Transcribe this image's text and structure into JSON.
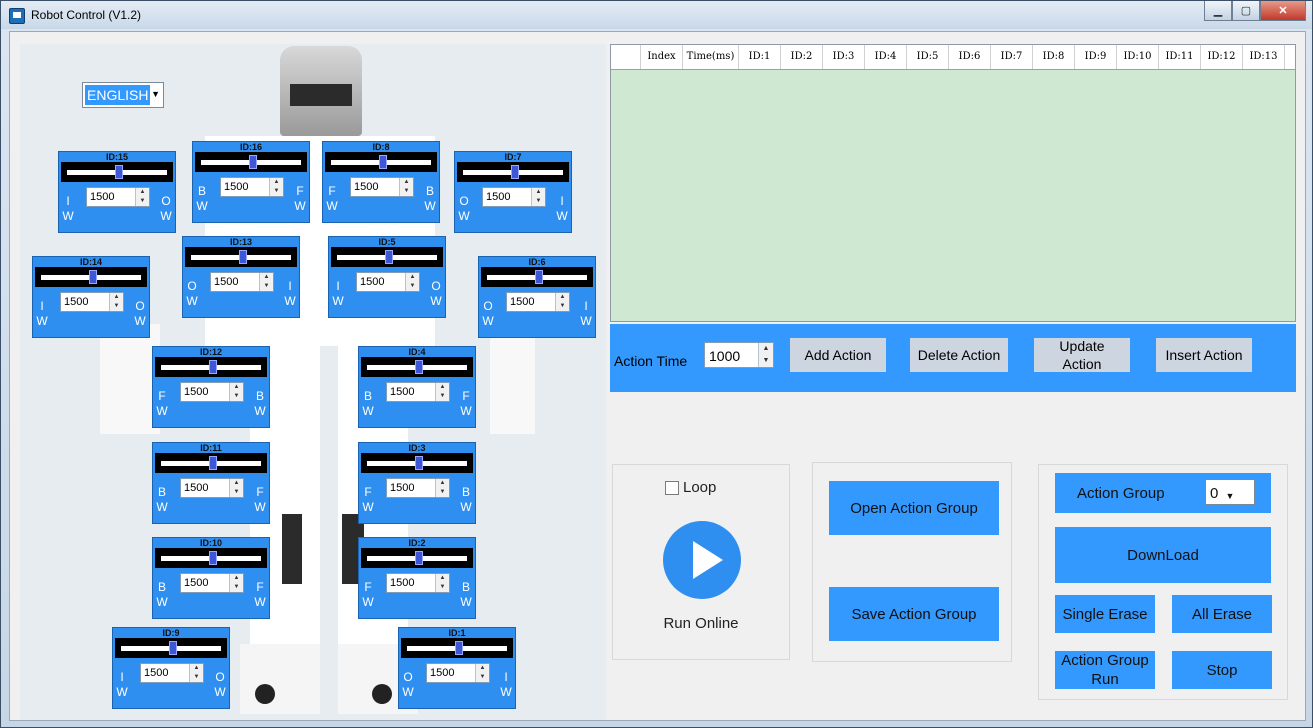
{
  "window": {
    "title": "Robot Control (V1.2)",
    "min": "▁",
    "max": "▢",
    "close": "✕"
  },
  "language": {
    "selected": "ENGLISH"
  },
  "servos": [
    {
      "id": "ID:15",
      "value": "1500",
      "left": "I\nW",
      "right": "O\nW"
    },
    {
      "id": "ID:16",
      "value": "1500",
      "left": "B\nW",
      "right": "F\nW"
    },
    {
      "id": "ID:8",
      "value": "1500",
      "left": "F\nW",
      "right": "B\nW"
    },
    {
      "id": "ID:7",
      "value": "1500",
      "left": "O\nW",
      "right": "I\nW"
    },
    {
      "id": "ID:14",
      "value": "1500",
      "left": "I\nW",
      "right": "O\nW"
    },
    {
      "id": "ID:13",
      "value": "1500",
      "left": "O\nW",
      "right": "I\nW"
    },
    {
      "id": "ID:5",
      "value": "1500",
      "left": "I\nW",
      "right": "O\nW"
    },
    {
      "id": "ID:6",
      "value": "1500",
      "left": "O\nW",
      "right": "I\nW"
    },
    {
      "id": "ID:12",
      "value": "1500",
      "left": "F\nW",
      "right": "B\nW"
    },
    {
      "id": "ID:4",
      "value": "1500",
      "left": "B\nW",
      "right": "F\nW"
    },
    {
      "id": "ID:11",
      "value": "1500",
      "left": "B\nW",
      "right": "F\nW"
    },
    {
      "id": "ID:3",
      "value": "1500",
      "left": "F\nW",
      "right": "B\nW"
    },
    {
      "id": "ID:10",
      "value": "1500",
      "left": "B\nW",
      "right": "F\nW"
    },
    {
      "id": "ID:2",
      "value": "1500",
      "left": "F\nW",
      "right": "B\nW"
    },
    {
      "id": "ID:9",
      "value": "1500",
      "left": "I\nW",
      "right": "O\nW"
    },
    {
      "id": "ID:1",
      "value": "1500",
      "left": "O\nW",
      "right": "I\nW"
    }
  ],
  "grid": {
    "columns": [
      "",
      "Index",
      "Time(ms)",
      "ID:1",
      "ID:2",
      "ID:3",
      "ID:4",
      "ID:5",
      "ID:6",
      "ID:7",
      "ID:8",
      "ID:9",
      "ID:10",
      "ID:11",
      "ID:12",
      "ID:13"
    ]
  },
  "action_bar": {
    "time_label": "Action Time",
    "time_value": "1000",
    "add": "Add Action",
    "delete": "Delete Action",
    "update": "Update\nAction",
    "insert": "Insert Action"
  },
  "run_panel": {
    "loop_label": "Loop",
    "run_label": "Run Online"
  },
  "file_panel": {
    "open": "Open Action Group",
    "save": "Save Action Group"
  },
  "device_panel": {
    "group_label": "Action Group",
    "group_value": "0",
    "download": "DownLoad",
    "single_erase": "Single Erase",
    "all_erase": "All Erase",
    "group_run": "Action Group\nRun",
    "stop": "Stop"
  }
}
